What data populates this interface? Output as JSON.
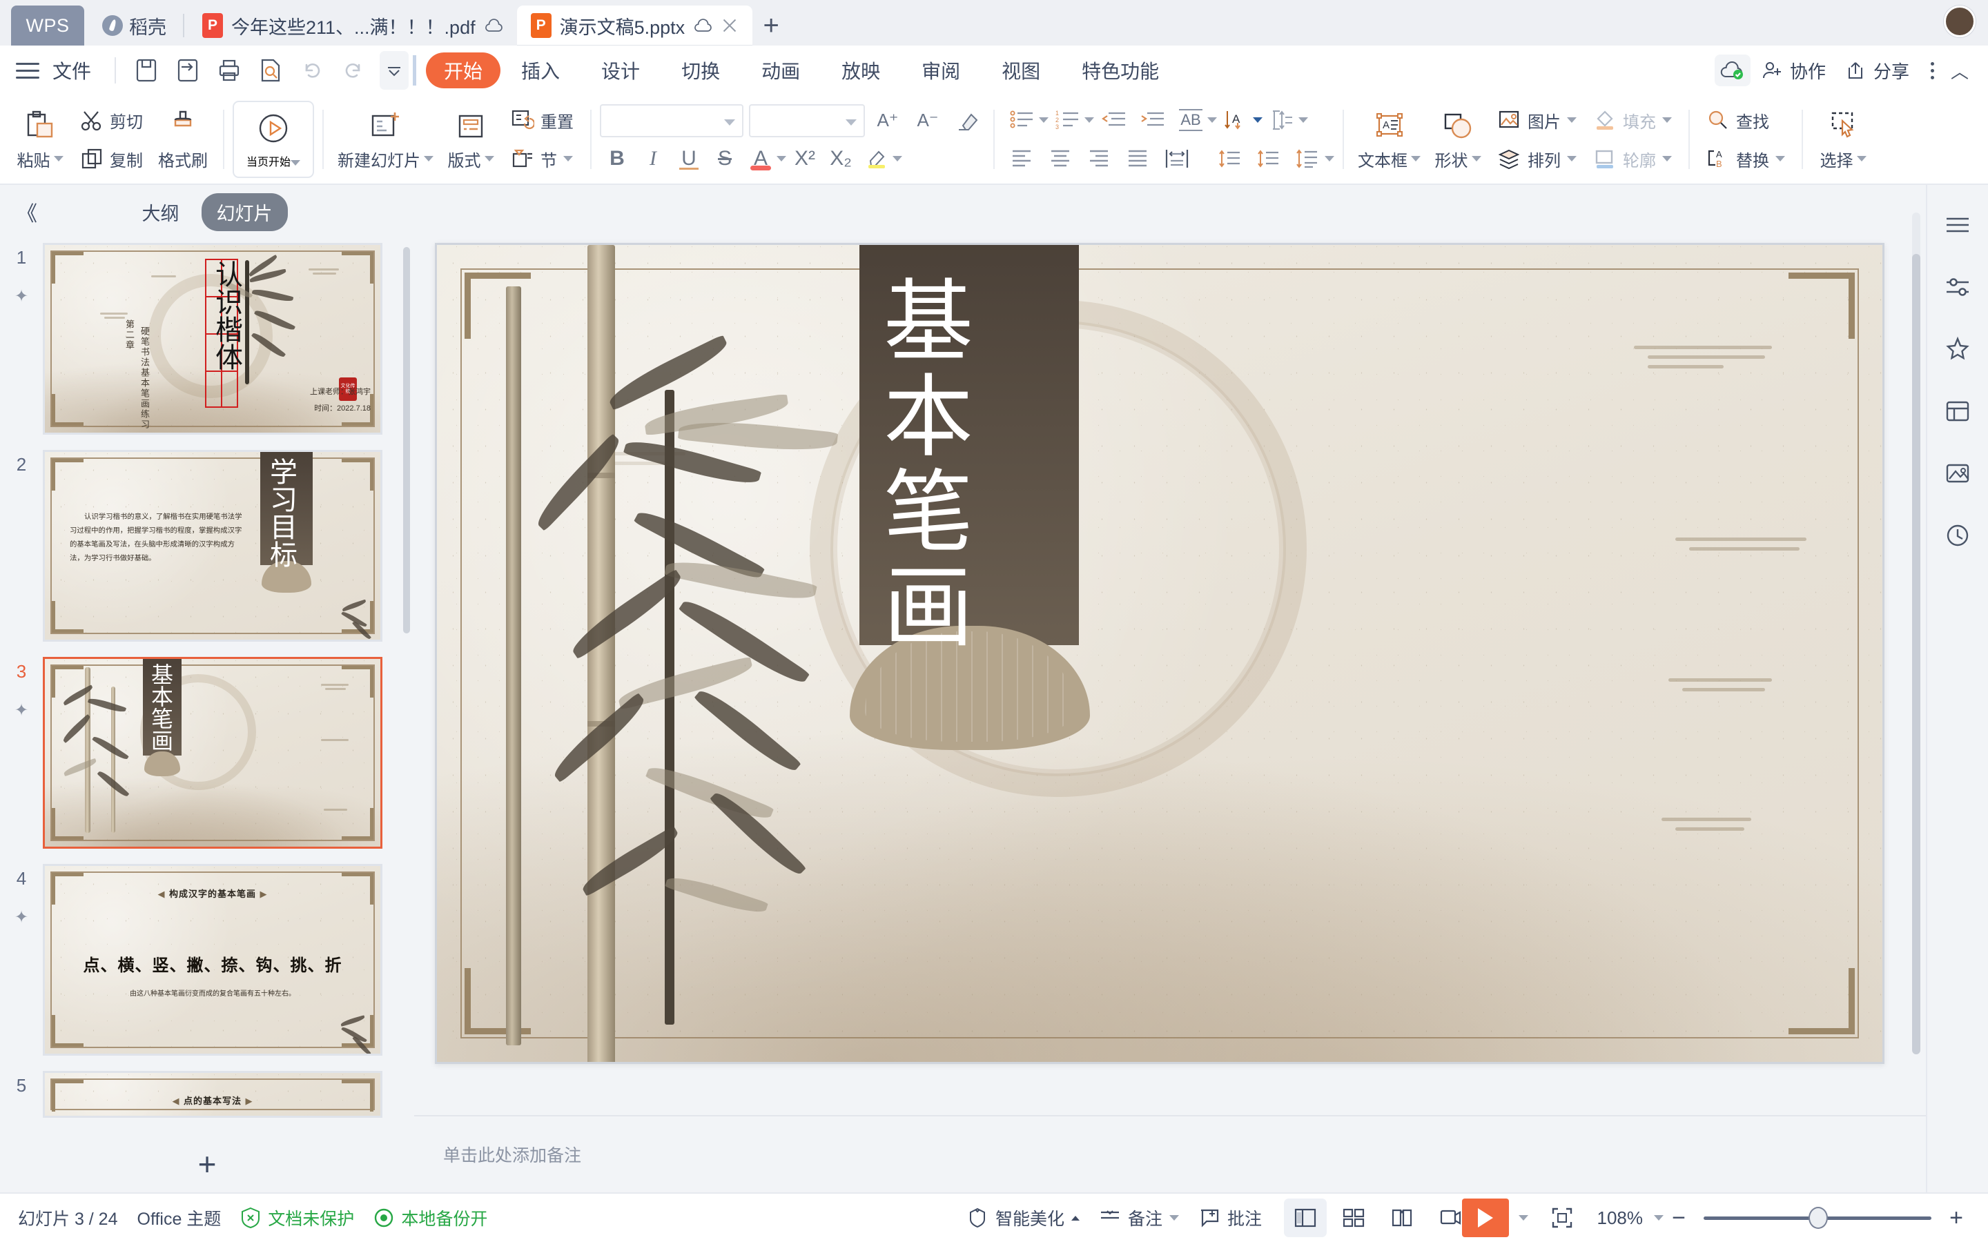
{
  "titlebar": {
    "wps_label": "WPS",
    "daoke_label": "稻壳",
    "tabs": [
      {
        "title": "今年这些211、...满！！！.pdf",
        "type": "pdf",
        "active": false,
        "cloud": true,
        "closable": false
      },
      {
        "title": "演示文稿5.pptx",
        "type": "ppt",
        "active": true,
        "cloud": true,
        "closable": true
      }
    ],
    "new_tab_label": "+"
  },
  "menubar": {
    "file_label": "文件",
    "quick_access": [
      "save-icon",
      "save-as-icon",
      "print-icon",
      "print-preview-icon",
      "undo-icon",
      "redo-icon"
    ],
    "customize_caret": "⌄",
    "ribbon_tabs": [
      {
        "label": "开始",
        "active": true
      },
      {
        "label": "插入",
        "active": false
      },
      {
        "label": "设计",
        "active": false
      },
      {
        "label": "切换",
        "active": false
      },
      {
        "label": "动画",
        "active": false
      },
      {
        "label": "放映",
        "active": false
      },
      {
        "label": "审阅",
        "active": false
      },
      {
        "label": "视图",
        "active": false
      },
      {
        "label": "特色功能",
        "active": false
      }
    ],
    "right": {
      "cloud_status": "cloud-sync-ok-icon",
      "collab_label": "协作",
      "share_label": "分享",
      "more_label": "more-vertical-icon",
      "collapse_label": "chevron-up-icon"
    }
  },
  "ribbon": {
    "clipboard": {
      "paste_label": "粘贴",
      "cut_label": "剪切",
      "copy_label": "复制",
      "format_painter_label": "格式刷"
    },
    "slideshow": {
      "start_here_label": "当页开始"
    },
    "slides": {
      "new_slide_label": "新建幻灯片",
      "layout_label": "版式",
      "reset_label": "重置",
      "section_label": "节"
    },
    "font": {
      "font_name_value": "",
      "font_size_value": "",
      "grow_label": "A⁺",
      "shrink_label": "A⁻",
      "clear_format_label": "clear-format-icon",
      "bold_label": "B",
      "italic_label": "I",
      "underline_label": "U",
      "strike_label": "S",
      "font_color_label": "A",
      "superscript_label": "X²",
      "subscript_label": "X₂",
      "highlight_label": "highlighter-icon"
    },
    "paragraph": {
      "bullets_label": "bullet-list-icon",
      "numbering_label": "numbered-list-icon",
      "decrease_indent_label": "decrease-indent-icon",
      "increase_indent_label": "increase-indent-icon",
      "text_direction_label": "AB",
      "align_text_label": "A",
      "line_spacing_label": "line-spacing-icon",
      "align_left_label": "align-left-icon",
      "align_center_label": "align-center-icon",
      "align_right_label": "align-right-icon",
      "align_justify_label": "align-justify-icon",
      "distribute_label": "distribute-icon",
      "vertical_top_label": "v-align-top-icon",
      "vertical_bottom_label": "v-align-bottom-icon",
      "line_height_label": "line-height-icon"
    },
    "insert": {
      "textbox_label": "文本框",
      "shape_label": "形状",
      "picture_label": "图片",
      "arrange_label": "排列",
      "fill_label": "填充",
      "outline_label": "轮廓"
    },
    "editing": {
      "find_label": "查找",
      "replace_label": "替换",
      "select_label": "选择"
    }
  },
  "sidebar": {
    "collapse_label": "《",
    "outline_tab": "大纲",
    "slides_tab": "幻灯片",
    "add_slide_label": "+",
    "thumbnails": [
      {
        "number": "1",
        "selected": false,
        "kind": "title",
        "vertical_title": "认识楷体",
        "chapter": "第二章",
        "subtitle": "硬笔书法基本笔画练习",
        "teacher": "上课老师：张鸿宇",
        "date": "时间：2022.7.18",
        "seal": "文化传统"
      },
      {
        "number": "2",
        "selected": false,
        "kind": "goal",
        "vertical_title": "学习目标",
        "body": "认识学习楷书的意义，了解楷书在实用硬笔书法学习过程中的作用，把握学习楷书的程度，掌握构成汉字的基本笔画及写法，在头脑中形成清晰的汉字构成方法，为学习行书做好基础。"
      },
      {
        "number": "3",
        "selected": true,
        "kind": "banner",
        "vertical_title": "基本笔画"
      },
      {
        "number": "4",
        "selected": false,
        "kind": "strokes",
        "heading": "构成汉字的基本笔画",
        "big_text": "点、横、竖、撇、捺、钩、挑、折",
        "caption": "由这八种基本笔画衍变而成的复合笔画有五十种左右。"
      },
      {
        "number": "5",
        "selected": false,
        "kind": "partial",
        "heading": "点的基本写法"
      }
    ]
  },
  "slide": {
    "vertical_title": "基本笔画"
  },
  "notes": {
    "placeholder": "单击此处添加备注"
  },
  "status": {
    "slide_counter": "幻灯片 3 / 24",
    "theme": "Office 主题",
    "protection": "文档未保护",
    "backup": "本地备份开",
    "beautify": "智能美化",
    "notes_label": "备注",
    "comment_label": "批注",
    "views": [
      "normal-view-icon",
      "slide-sorter-icon",
      "reading-view-icon",
      "presenter-view-icon"
    ],
    "play_label": "play-icon",
    "fit_label": "fit-to-window-icon",
    "zoom_value": "108%",
    "zoom_out_label": "−",
    "zoom_in_label": "+"
  },
  "colors": {
    "accent": "#f2683c",
    "menu_text": "#3f4b63",
    "panel_bg": "#f2f4f7",
    "selected_border": "#e8603c",
    "green": "#27a745"
  }
}
